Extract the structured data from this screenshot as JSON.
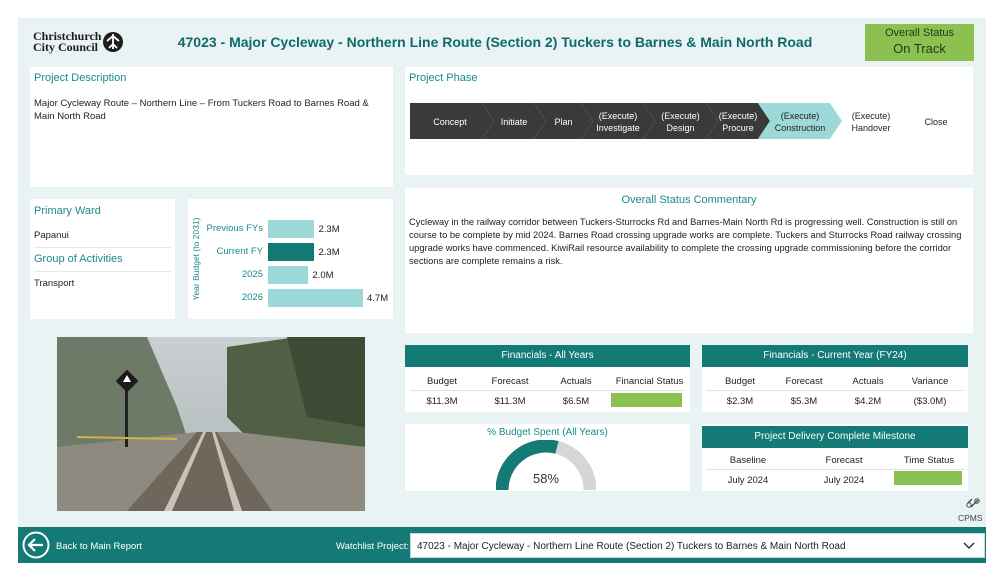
{
  "header": {
    "logo_line1": "Christchurch",
    "logo_line2": "City Council",
    "title": "47023 - Major Cycleway - Northern Line Route (Section 2) Tuckers to Barnes & Main North Road",
    "overall_status_label": "Overall Status",
    "overall_status_value": "On Track"
  },
  "description": {
    "label": "Project Description",
    "text": "Major Cycleway Route – Northern Line – From Tuckers Road to Barnes Road & Main North Road"
  },
  "phase": {
    "label": "Project Phase",
    "steps": [
      {
        "l1": "Concept",
        "l2": ""
      },
      {
        "l1": "Initiate",
        "l2": ""
      },
      {
        "l1": "Plan",
        "l2": ""
      },
      {
        "l1": "(Execute)",
        "l2": "Investigate"
      },
      {
        "l1": "(Execute)",
        "l2": "Design"
      },
      {
        "l1": "(Execute)",
        "l2": "Procure"
      },
      {
        "l1": "(Execute)",
        "l2": "Construction"
      },
      {
        "l1": "(Execute)",
        "l2": "Handover"
      },
      {
        "l1": "Close",
        "l2": ""
      }
    ],
    "current": "Construction"
  },
  "ward": {
    "primary_ward_label": "Primary Ward",
    "primary_ward_value": "Papanui",
    "group_label": "Group of Activities",
    "group_value": "Transport"
  },
  "budget_chart": {
    "ylabel": "Year Budget (to 2031)",
    "rows": [
      {
        "label": "Previous FYs",
        "value": 2.3,
        "text": "2.3M"
      },
      {
        "label": "Current FY",
        "value": 2.3,
        "text": "2.3M"
      },
      {
        "label": "2025",
        "value": 2.0,
        "text": "2.0M"
      },
      {
        "label": "2026",
        "value": 4.7,
        "text": "4.7M"
      }
    ]
  },
  "commentary": {
    "label": "Overall Status Commentary",
    "text": "Cycleway in the railway corridor between Tuckers-Sturrocks Rd and Barnes-Main North Rd is progressing well. Construction is still on course to be complete by mid 2024. Barnes Road crossing upgrade works are complete. Tuckers and Sturrocks Road railway crossing upgrade works have commenced. KiwiRail resource availability to complete the crossing upgrade commissioning before the corridor sections are complete remains a risk."
  },
  "fin_all": {
    "title": "Financials - All Years",
    "headers": [
      "Budget",
      "Forecast",
      "Actuals",
      "Financial Status"
    ],
    "values": [
      "$11.3M",
      "$11.3M",
      "$6.5M"
    ],
    "status_color": "#8cc152"
  },
  "fin_current": {
    "title": "Financials - Current Year (FY24)",
    "headers": [
      "Budget",
      "Forecast",
      "Actuals",
      "Variance"
    ],
    "values": [
      "$2.3M",
      "$5.3M",
      "$4.2M",
      "($3.0M)"
    ]
  },
  "budget_spent": {
    "title": "% Budget Spent (All Years)",
    "percent": 58,
    "text": "58%"
  },
  "milestone": {
    "title": "Project Delivery Complete Milestone",
    "headers": [
      "Baseline",
      "Forecast",
      "Time Status"
    ],
    "values": [
      "July 2024",
      "July 2024"
    ],
    "status_color": "#8cc152"
  },
  "cpms": "CPMS",
  "footer": {
    "back_label": "Back to Main Report",
    "watchlist_label": "Watchlist Project:",
    "watchlist_value": "47023 - Major Cycleway - Northern Line Route (Section 2) Tuckers to Barnes & Main North Road"
  },
  "colors": {
    "accent": "#137a76",
    "phase_dark": "#3a3a3a",
    "phase_current": "#9cd9d8",
    "bar_light": "#9cd9d8",
    "bar_dark": "#137a76"
  }
}
